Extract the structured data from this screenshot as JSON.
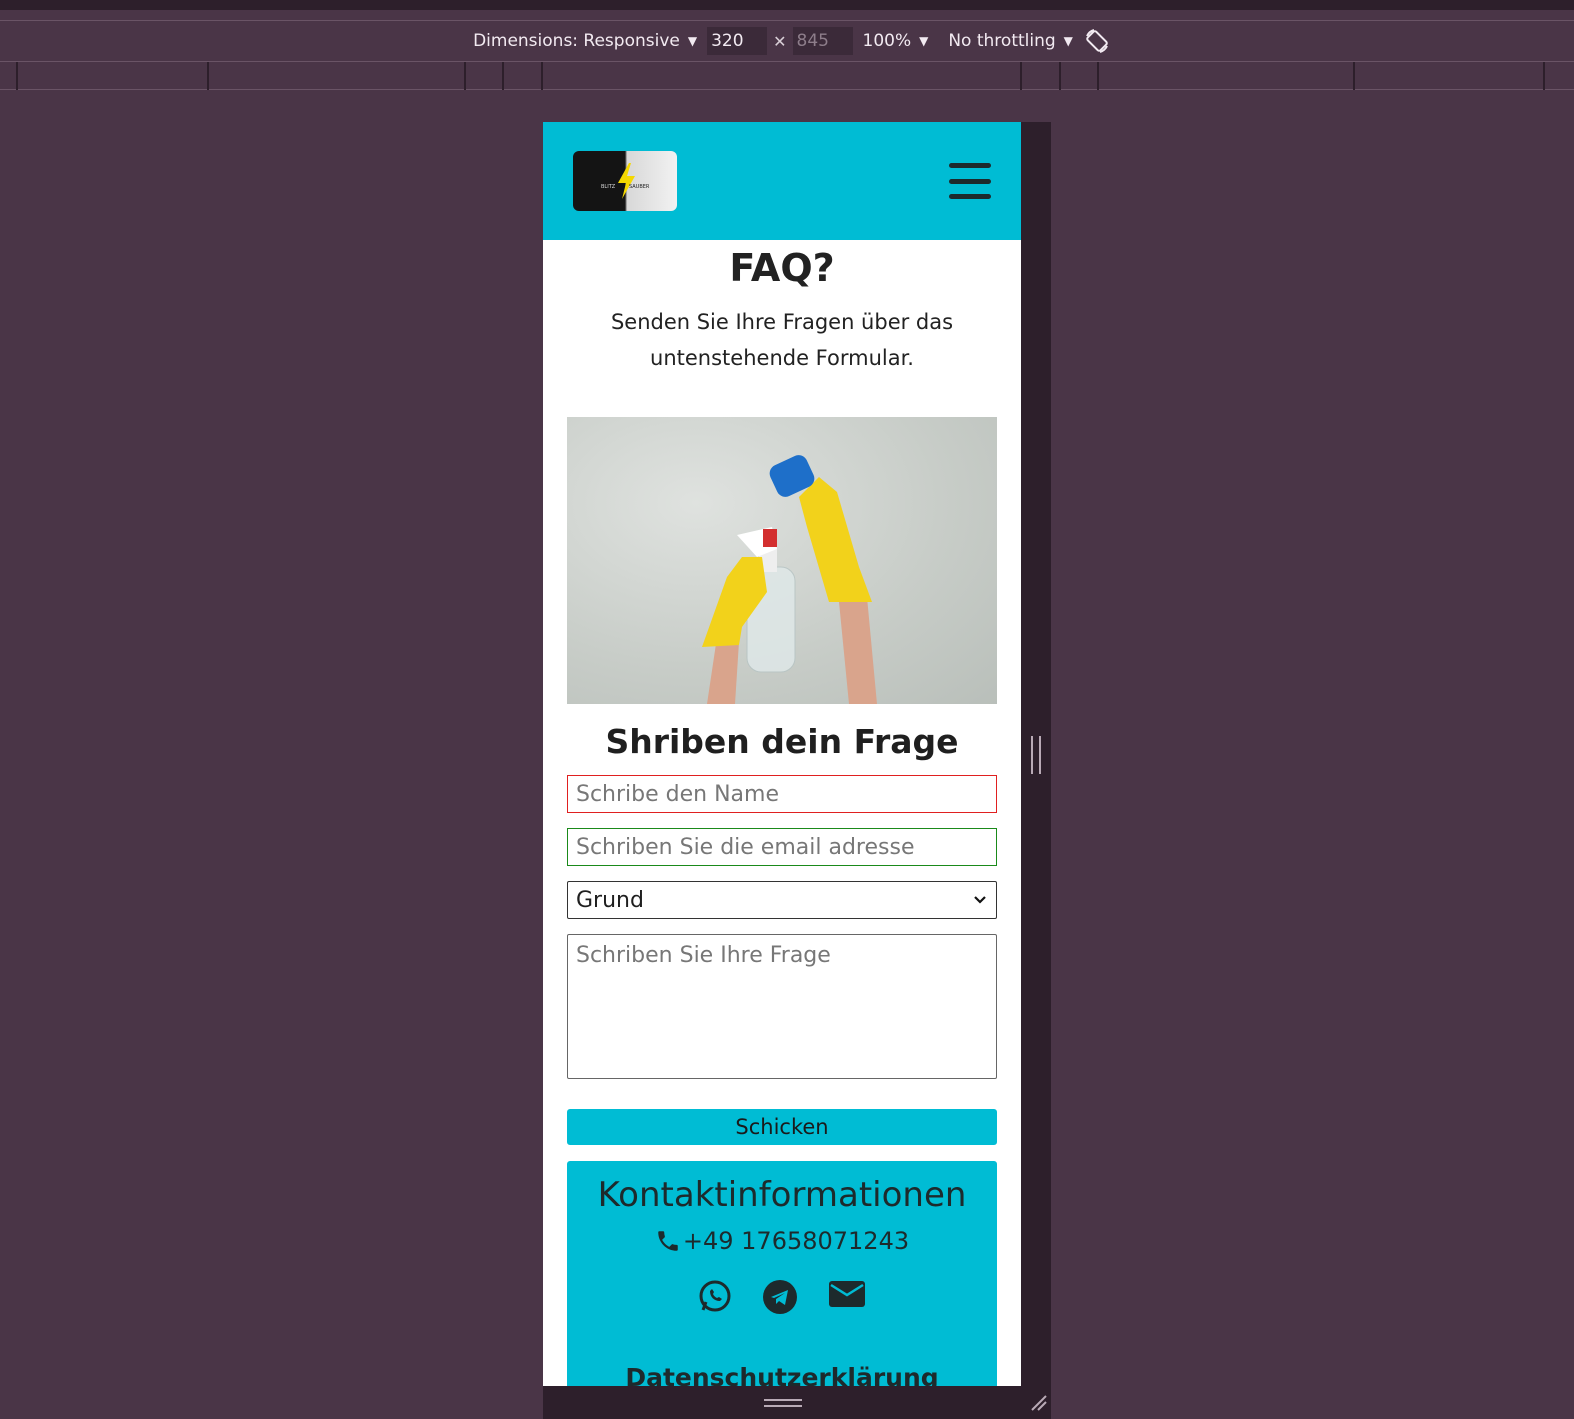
{
  "devtools": {
    "dimensions_label": "Dimensions: Responsive",
    "width_value": "320",
    "height_value": "845",
    "zoom": "100%",
    "throttling": "No throttling"
  },
  "site": {
    "logo_text_left": "BLITZ",
    "logo_text_right": "SAUBER",
    "faq_title": "FAQ?",
    "faq_subtitle": "Senden Sie Ihre Fragen über das untenstehende Formular.",
    "form_title": "Shriben dein Frage",
    "name_placeholder": "Schribe den Name",
    "email_placeholder": "Schriben Sie die email adresse",
    "reason_selected": "Grund",
    "question_placeholder": "Schriben Sie Ihre Frage",
    "submit_label": "Schicken",
    "contact_title": "Kontaktinformationen",
    "phone": "+49 17658071243",
    "privacy_label": "Datenschutzerklärung",
    "icons": [
      "phone-icon",
      "whatsapp-icon",
      "telegram-icon",
      "mail-icon"
    ],
    "colors": {
      "accent": "#00bcd4",
      "name_border": "#e02020",
      "email_border": "#1a8a1a"
    }
  }
}
